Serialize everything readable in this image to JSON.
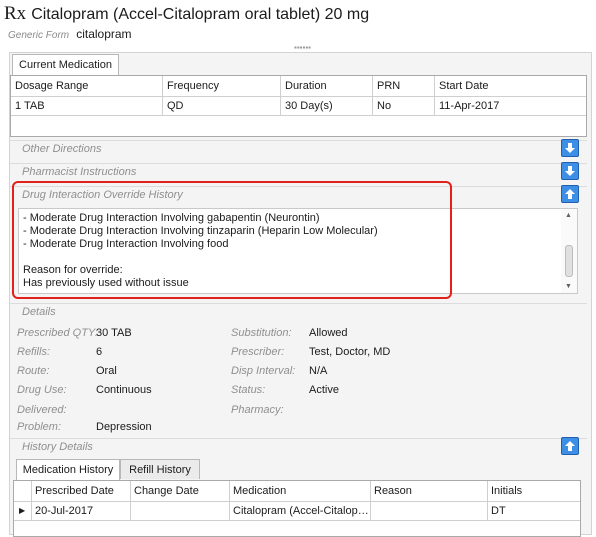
{
  "header": {
    "rx_label": "Rx",
    "title": "Citalopram (Accel-Citalopram oral tablet) 20 mg",
    "generic_form_label": "Generic Form",
    "generic_form_value": "citalopram"
  },
  "tabs": {
    "current_medication": "Current Medication"
  },
  "current_medication": {
    "columns": [
      "Dosage Range",
      "Frequency",
      "Duration",
      "PRN",
      "Start Date"
    ],
    "rows": [
      [
        "1 TAB",
        "QD",
        "30 Day(s)",
        "No",
        "11-Apr-2017"
      ]
    ]
  },
  "sections": {
    "other_directions": "Other Directions",
    "pharmacist_instructions": "Pharmacist Instructions",
    "drug_interaction": "Drug Interaction Override History",
    "details": "Details",
    "history_details": "History Details"
  },
  "override": {
    "lines": [
      "- Moderate Drug Interaction Involving gabapentin (Neurontin)",
      "- Moderate Drug Interaction Involving tinzaparin (Heparin Low Molecular)",
      "- Moderate Drug Interaction Involving food",
      "",
      "Reason for override:",
      "Has previously used without issue"
    ]
  },
  "details": {
    "prescribed_qty_label": "Prescribed QTY:",
    "prescribed_qty_value": "30 TAB",
    "refills_label": "Refills:",
    "refills_value": "6",
    "route_label": "Route:",
    "route_value": "Oral",
    "drug_use_label": "Drug Use:",
    "drug_use_value": "Continuous",
    "delivered_label": "Delivered:",
    "delivered_value": "",
    "problem_label": "Problem:",
    "problem_value": "Depression",
    "substitution_label": "Substitution:",
    "substitution_value": "Allowed",
    "prescriber_label": "Prescriber:",
    "prescriber_value": "Test, Doctor, MD",
    "disp_interval_label": "Disp Interval:",
    "disp_interval_value": "N/A",
    "status_label": "Status:",
    "status_value": "Active",
    "pharmacy_label": "Pharmacy:",
    "pharmacy_value": ""
  },
  "history": {
    "tabs": [
      "Medication History",
      "Refill History"
    ],
    "columns": [
      "Prescribed Date",
      "Change Date",
      "Medication",
      "Reason",
      "Initials"
    ],
    "rows": [
      [
        "20-Jul-2017",
        "",
        "Citalopram (Accel-Citalop…",
        "",
        "DT"
      ]
    ],
    "row_indicator": "▶"
  },
  "colors": {
    "toggle_blue": "#3d8ee5",
    "highlight_red": "#e2211c"
  },
  "icons": {
    "collapse_toggle": "arrow-down-icon",
    "expand_toggle": "arrow-up-icon"
  }
}
